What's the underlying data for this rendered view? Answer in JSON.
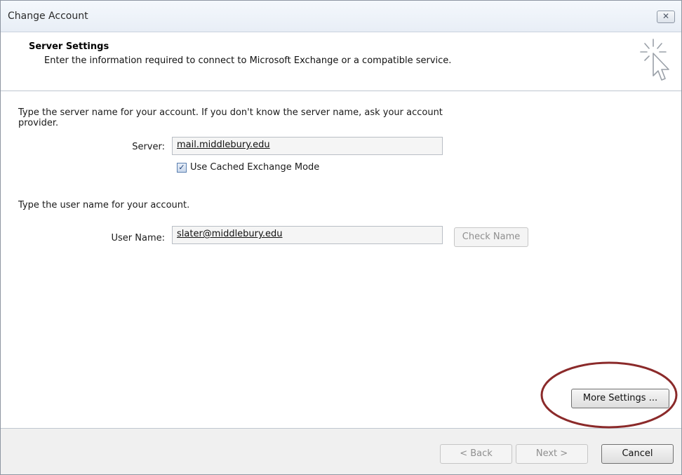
{
  "window": {
    "title": "Change Account",
    "close_glyph": "✕"
  },
  "header": {
    "title": "Server Settings",
    "subtitle": "Enter the information required to connect to Microsoft Exchange or a compatible service.",
    "icon": "wizard-cursor-icon"
  },
  "server_section": {
    "instruction": "Type the server name for your account. If you don't know the server name, ask your account provider.",
    "server_label": "Server:",
    "server_value": "mail.middlebury.edu",
    "cached_mode_label": "Use Cached Exchange Mode",
    "cached_mode_checked": true
  },
  "user_section": {
    "instruction": "Type the user name for your account.",
    "username_label": "User Name:",
    "username_value": "slater@middlebury.edu",
    "check_name_label": "Check Name"
  },
  "more_settings_label": "More Settings ...",
  "footer": {
    "back_label": "< Back",
    "next_label": "Next >",
    "cancel_label": "Cancel"
  },
  "colors": {
    "highlight_ellipse": "#8b2a2a"
  }
}
